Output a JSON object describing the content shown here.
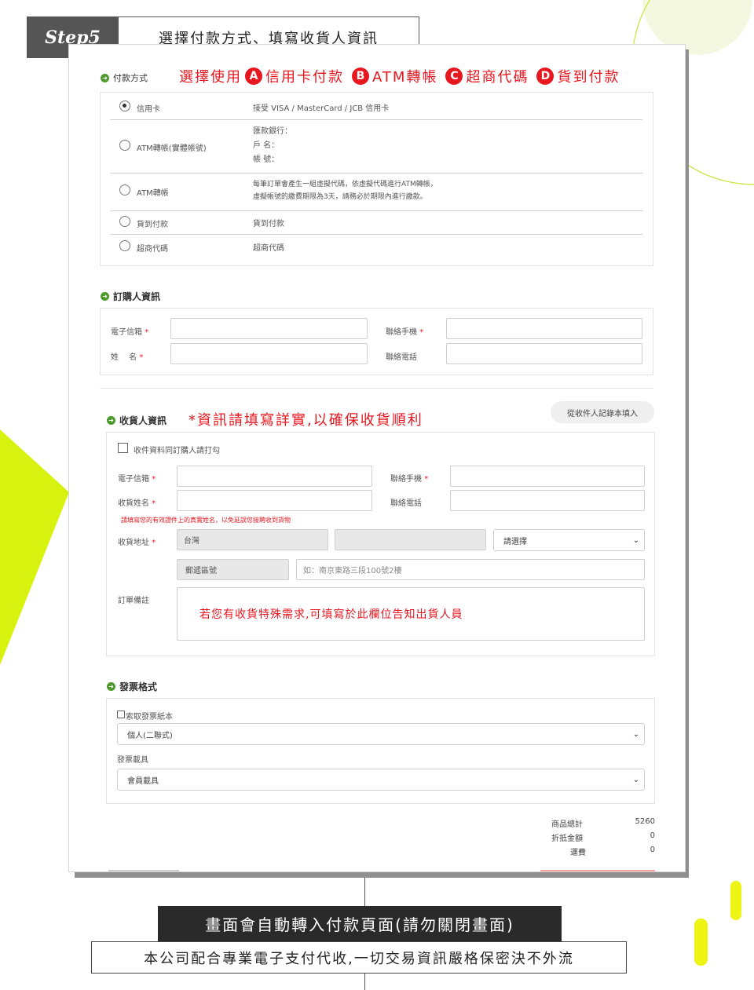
{
  "colors": {
    "accent_red": "#e8161f",
    "lime": "#d7f20f",
    "step_bg": "#555555",
    "bar_dark": "#2a2a2a",
    "icon_green": "#4c9a2a"
  },
  "step": {
    "label": "Step5",
    "title": "選擇付款方式、填寫收貨人資訊"
  },
  "payment": {
    "title": "付款方式",
    "note": {
      "prefix": "選擇使用",
      "a": "A",
      "a_text": "信用卡付款",
      "b": "B",
      "b_text": "ATM轉帳",
      "c": "C",
      "c_text": "超商代碼",
      "d": "D",
      "d_text": "貨到付款"
    },
    "options": [
      {
        "label": "信用卡",
        "checked": true,
        "lines": [
          "接受 VISA / MasterCard / JCB 信用卡"
        ]
      },
      {
        "label": "ATM轉帳(實體帳號)",
        "checked": false,
        "lines": [
          "匯款銀行：",
          "戶 名：",
          "帳 號："
        ]
      },
      {
        "label": "ATM轉帳",
        "checked": false,
        "lines": [
          "每筆訂單會產生一組虛擬代碼，依虛擬代碼進行ATM轉帳，",
          "虛擬帳號的繳費期限為3天，請務必於期限內進行繳款。"
        ]
      },
      {
        "label": "貨到付款",
        "checked": false,
        "lines": [
          "貨到付款"
        ]
      },
      {
        "label": "超商代碼",
        "checked": false,
        "lines": [
          "超商代碼"
        ]
      }
    ]
  },
  "buyer": {
    "title": "訂購人資訊",
    "email_label": "電子信箱",
    "mobile_label": "聯絡手機",
    "name_label": "姓　 名",
    "phone_label": "聯絡電話",
    "required_mark": "*"
  },
  "receiver": {
    "title": "收貨人資訊",
    "note": "*資訊請填寫詳實,以確保收貨順利",
    "fill_button": "從收件人記錄本填入",
    "same_checkbox": "收件資料同訂購人請打勾",
    "email_label": "電子信箱",
    "mobile_label": "聯絡手機",
    "name_label": "收貨姓名",
    "phone_label": "聯絡電話",
    "name_hint": "請填寫您的有效證件上的真實姓名，以免延誤您接聘收到貨物",
    "address_label": "收貨地址",
    "country_value": "台灣",
    "district_select": "請選擇",
    "zip_placeholder": "郵遞區號",
    "street_placeholder": "如：南京東路三段100號2樓",
    "remark_label": "訂單備註",
    "remark_note": "若您有收貨特殊需求,可填寫於此欄位告知出貨人員"
  },
  "invoice": {
    "title": "發票格式",
    "paper_checkbox": "索取發票紙本",
    "type_select": "個人(二聯式)",
    "carrier_label": "發票載具",
    "carrier_select": "會員載具"
  },
  "summary": [
    {
      "label": "商品總計",
      "value": "5260"
    },
    {
      "label": "折抵金額",
      "value": "0"
    },
    {
      "label": "運費",
      "value": "0"
    }
  ],
  "bottom": {
    "redirect_text": "畫面會自動轉入付款頁面(請勿關閉畫面)",
    "security_text": "本公司配合專業電子支付代收,一切交易資訊嚴格保密決不外流"
  }
}
